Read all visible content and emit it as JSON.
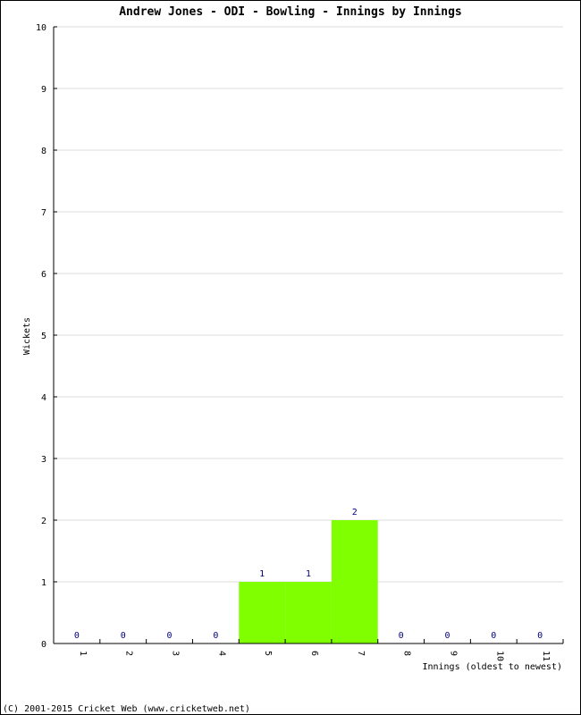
{
  "chart_data": {
    "type": "bar",
    "title": "Andrew Jones - ODI - Bowling - Innings by Innings",
    "xlabel": "Innings (oldest to newest)",
    "ylabel": "Wickets",
    "categories": [
      "1",
      "2",
      "3",
      "4",
      "5",
      "6",
      "7",
      "8",
      "9",
      "10",
      "11"
    ],
    "values": [
      0,
      0,
      0,
      0,
      1,
      1,
      2,
      0,
      0,
      0,
      0
    ],
    "ylim": [
      0,
      10
    ],
    "yticks": [
      "0",
      "1",
      "2",
      "3",
      "4",
      "5",
      "6",
      "7",
      "8",
      "9",
      "10"
    ],
    "grid": true,
    "bar_color": "#80ff00",
    "label_color": "#000080"
  },
  "footer": "(C) 2001-2015 Cricket Web (www.cricketweb.net)"
}
